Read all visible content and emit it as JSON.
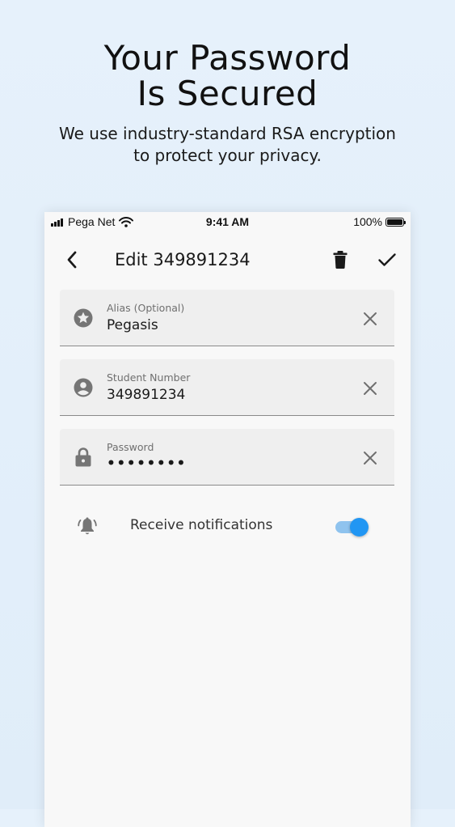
{
  "promo": {
    "headline_line1": "Your Password",
    "headline_line2": "Is Secured",
    "subtitle_line1": "We use industry-standard RSA encryption",
    "subtitle_line2": "to protect your privacy."
  },
  "status_bar": {
    "carrier": "Pega Net",
    "time": "9:41 AM",
    "battery": "100%",
    "signal_icon": "signal-bars-icon",
    "wifi_icon": "wifi-icon",
    "battery_icon": "battery-icon"
  },
  "app_bar": {
    "title": "Edit 349891234",
    "back_icon": "back-arrow-icon",
    "delete_icon": "trash-icon",
    "save_icon": "checkmark-icon"
  },
  "form": {
    "fields": [
      {
        "label": "Alias (Optional)",
        "value": "Pegasis",
        "icon": "star-circle-icon",
        "clear_icon": "close-icon"
      },
      {
        "label": "Student Number",
        "value": "349891234",
        "icon": "account-circle-icon",
        "clear_icon": "close-icon"
      },
      {
        "label": "Password",
        "value": "••••••••",
        "icon": "lock-icon",
        "clear_icon": "close-icon"
      }
    ],
    "notifications": {
      "label": "Receive notifications",
      "icon": "bell-icon",
      "enabled": true
    }
  },
  "colors": {
    "background": "#e6f1fb",
    "screen": "#f8f8f8",
    "field_fill": "#efefef",
    "accent": "#2196f3",
    "toggle_track": "#8fc3ee",
    "icon_gray": "#757575"
  }
}
